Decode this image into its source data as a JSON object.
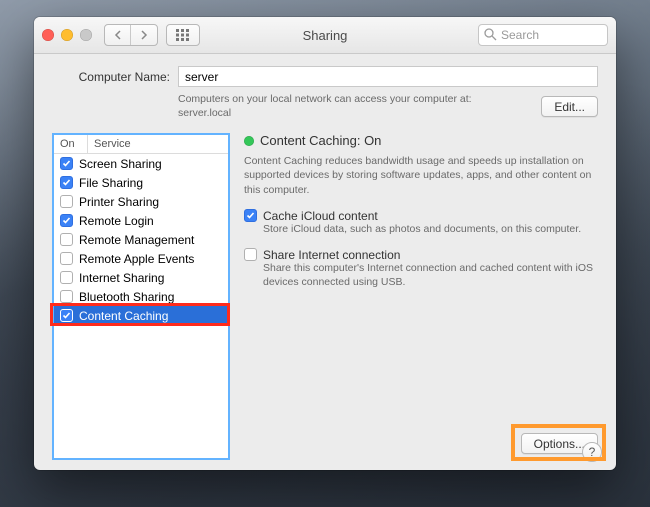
{
  "titlebar": {
    "title": "Sharing",
    "search_placeholder": "Search"
  },
  "computer_name": {
    "label": "Computer Name:",
    "value": "server",
    "subtext_line1": "Computers on your local network can access your computer at:",
    "subtext_line2": "server.local",
    "edit_label": "Edit..."
  },
  "service_table": {
    "col_on": "On",
    "col_service": "Service",
    "items": [
      {
        "label": "Screen Sharing",
        "checked": true
      },
      {
        "label": "File Sharing",
        "checked": true
      },
      {
        "label": "Printer Sharing",
        "checked": false
      },
      {
        "label": "Remote Login",
        "checked": true
      },
      {
        "label": "Remote Management",
        "checked": false
      },
      {
        "label": "Remote Apple Events",
        "checked": false
      },
      {
        "label": "Internet Sharing",
        "checked": false
      },
      {
        "label": "Bluetooth Sharing",
        "checked": false
      },
      {
        "label": "Content Caching",
        "checked": true,
        "selected": true
      }
    ]
  },
  "detail": {
    "status_title": "Content Caching: On",
    "description": "Content Caching reduces bandwidth usage and speeds up installation on supported devices by storing software updates, apps, and other content on this computer.",
    "cache_icloud": {
      "checked": true,
      "label": "Cache iCloud content",
      "sub": "Store iCloud data, such as photos and documents, on this computer."
    },
    "share_internet": {
      "checked": false,
      "label": "Share Internet connection",
      "sub": "Share this computer's Internet connection and cached content with iOS devices connected using USB."
    },
    "options_label": "Options..."
  },
  "help_label": "?"
}
